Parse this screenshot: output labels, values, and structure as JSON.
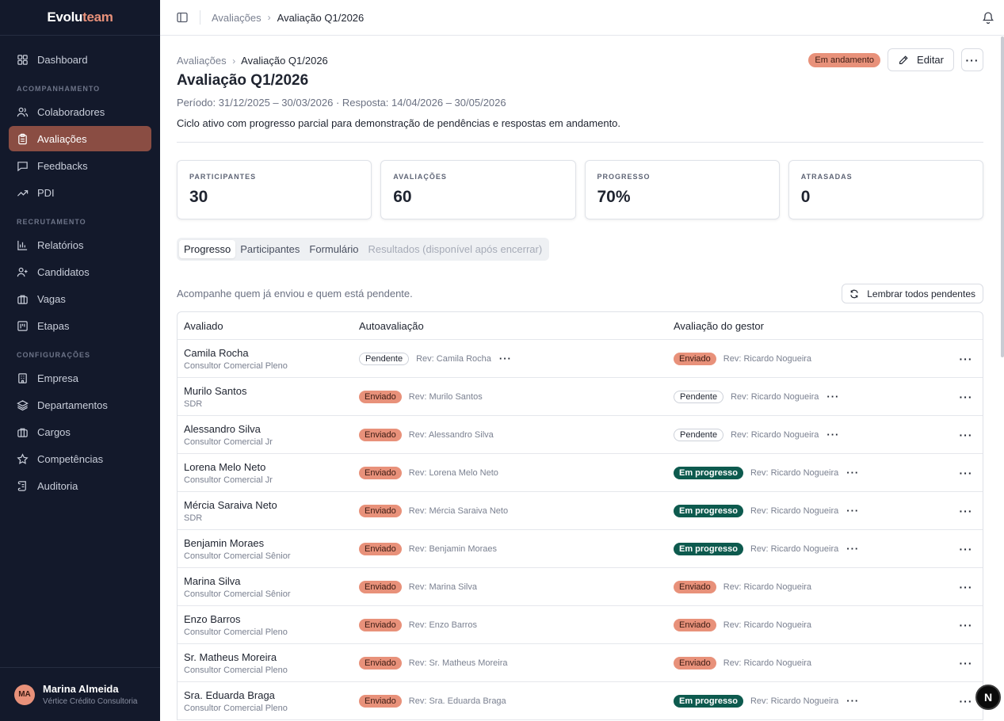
{
  "brand": {
    "part1": "Evolu",
    "part2": "team"
  },
  "sidebar": {
    "dashboard": "Dashboard",
    "section_acompanhamento": "ACOMPANHAMENTO",
    "colaboradores": "Colaboradores",
    "avaliacoes": "Avaliações",
    "feedbacks": "Feedbacks",
    "pdi": "PDI",
    "section_recrutamento": "RECRUTAMENTO",
    "relatorios": "Relatórios",
    "candidatos": "Candidatos",
    "vagas": "Vagas",
    "etapas": "Etapas",
    "section_configuracoes": "CONFIGURAÇÕES",
    "empresa": "Empresa",
    "departamentos": "Departamentos",
    "cargos": "Cargos",
    "competencias": "Competências",
    "auditoria": "Auditoria"
  },
  "user": {
    "initials": "MA",
    "name": "Marina Almeida",
    "org": "Vértice Crédito Consultoria"
  },
  "topbar": {
    "crumb_parent": "Avaliações",
    "crumb_current": "Avaliação Q1/2026"
  },
  "page": {
    "crumb_parent": "Avaliações",
    "crumb_sep": "›",
    "crumb_current": "Avaliação Q1/2026",
    "title": "Avaliação Q1/2026",
    "period": "Período: 31/12/2025 – 30/03/2026 · Resposta: 14/04/2026 – 30/05/2026",
    "description": "Ciclo ativo com progresso parcial para demonstração de pendências e respostas em andamento.",
    "status_badge": "Em andamento",
    "edit_label": "Editar",
    "more_label": "···"
  },
  "stats": [
    {
      "label": "PARTICIPANTES",
      "value": "30"
    },
    {
      "label": "AVALIAÇÕES",
      "value": "60"
    },
    {
      "label": "PROGRESSO",
      "value": "70%"
    },
    {
      "label": "ATRASADAS",
      "value": "0"
    }
  ],
  "tabs": {
    "progresso": "Progresso",
    "participantes": "Participantes",
    "formulario": "Formulário",
    "resultados": "Resultados (disponível após encerrar)"
  },
  "list": {
    "caption": "Acompanhe quem já enviou e quem está pendente.",
    "remind_label": "Lembrar todos pendentes"
  },
  "table": {
    "headers": {
      "avaliado": "Avaliado",
      "auto": "Autoavaliação",
      "gestor": "Avaliação do gestor"
    },
    "dots": "···",
    "rows": [
      {
        "name": "Camila Rocha",
        "role": "Consultor Comercial Pleno",
        "auto_status": "Pendente",
        "auto_type": "pending",
        "auto_rev": "Rev: Camila Rocha",
        "gestor_status": "Enviado",
        "gestor_type": "sent",
        "gestor_rev": "Rev: Ricardo Nogueira"
      },
      {
        "name": "Murilo Santos",
        "role": "SDR",
        "auto_status": "Enviado",
        "auto_type": "sent",
        "auto_rev": "Rev: Murilo Santos",
        "gestor_status": "Pendente",
        "gestor_type": "pending",
        "gestor_rev": "Rev: Ricardo Nogueira"
      },
      {
        "name": "Alessandro Silva",
        "role": "Consultor Comercial Jr",
        "auto_status": "Enviado",
        "auto_type": "sent",
        "auto_rev": "Rev: Alessandro Silva",
        "gestor_status": "Pendente",
        "gestor_type": "pending",
        "gestor_rev": "Rev: Ricardo Nogueira"
      },
      {
        "name": "Lorena Melo Neto",
        "role": "Consultor Comercial Jr",
        "auto_status": "Enviado",
        "auto_type": "sent",
        "auto_rev": "Rev: Lorena Melo Neto",
        "gestor_status": "Em progresso",
        "gestor_type": "progress",
        "gestor_rev": "Rev: Ricardo Nogueira"
      },
      {
        "name": "Mércia Saraiva Neto",
        "role": "SDR",
        "auto_status": "Enviado",
        "auto_type": "sent",
        "auto_rev": "Rev: Mércia Saraiva Neto",
        "gestor_status": "Em progresso",
        "gestor_type": "progress",
        "gestor_rev": "Rev: Ricardo Nogueira"
      },
      {
        "name": "Benjamin Moraes",
        "role": "Consultor Comercial Sênior",
        "auto_status": "Enviado",
        "auto_type": "sent",
        "auto_rev": "Rev: Benjamin Moraes",
        "gestor_status": "Em progresso",
        "gestor_type": "progress",
        "gestor_rev": "Rev: Ricardo Nogueira"
      },
      {
        "name": "Marina Silva",
        "role": "Consultor Comercial Sênior",
        "auto_status": "Enviado",
        "auto_type": "sent",
        "auto_rev": "Rev: Marina Silva",
        "gestor_status": "Enviado",
        "gestor_type": "sent",
        "gestor_rev": "Rev: Ricardo Nogueira"
      },
      {
        "name": "Enzo Barros",
        "role": "Consultor Comercial Pleno",
        "auto_status": "Enviado",
        "auto_type": "sent",
        "auto_rev": "Rev: Enzo Barros",
        "gestor_status": "Enviado",
        "gestor_type": "sent",
        "gestor_rev": "Rev: Ricardo Nogueira"
      },
      {
        "name": "Sr. Matheus Moreira",
        "role": "Consultor Comercial Pleno",
        "auto_status": "Enviado",
        "auto_type": "sent",
        "auto_rev": "Rev: Sr. Matheus Moreira",
        "gestor_status": "Enviado",
        "gestor_type": "sent",
        "gestor_rev": "Rev: Ricardo Nogueira"
      },
      {
        "name": "Sra. Eduarda Braga",
        "role": "Consultor Comercial Pleno",
        "auto_status": "Enviado",
        "auto_type": "sent",
        "auto_rev": "Rev: Sra. Eduarda Braga",
        "gestor_status": "Em progresso",
        "gestor_type": "progress",
        "gestor_rev": "Rev: Ricardo Nogueira"
      }
    ]
  },
  "fab": "N",
  "colors": {
    "sidebar_bg": "#13192b",
    "accent": "#e8917a",
    "active_nav": "#8a4d43",
    "progress": "#0d5a4e"
  }
}
